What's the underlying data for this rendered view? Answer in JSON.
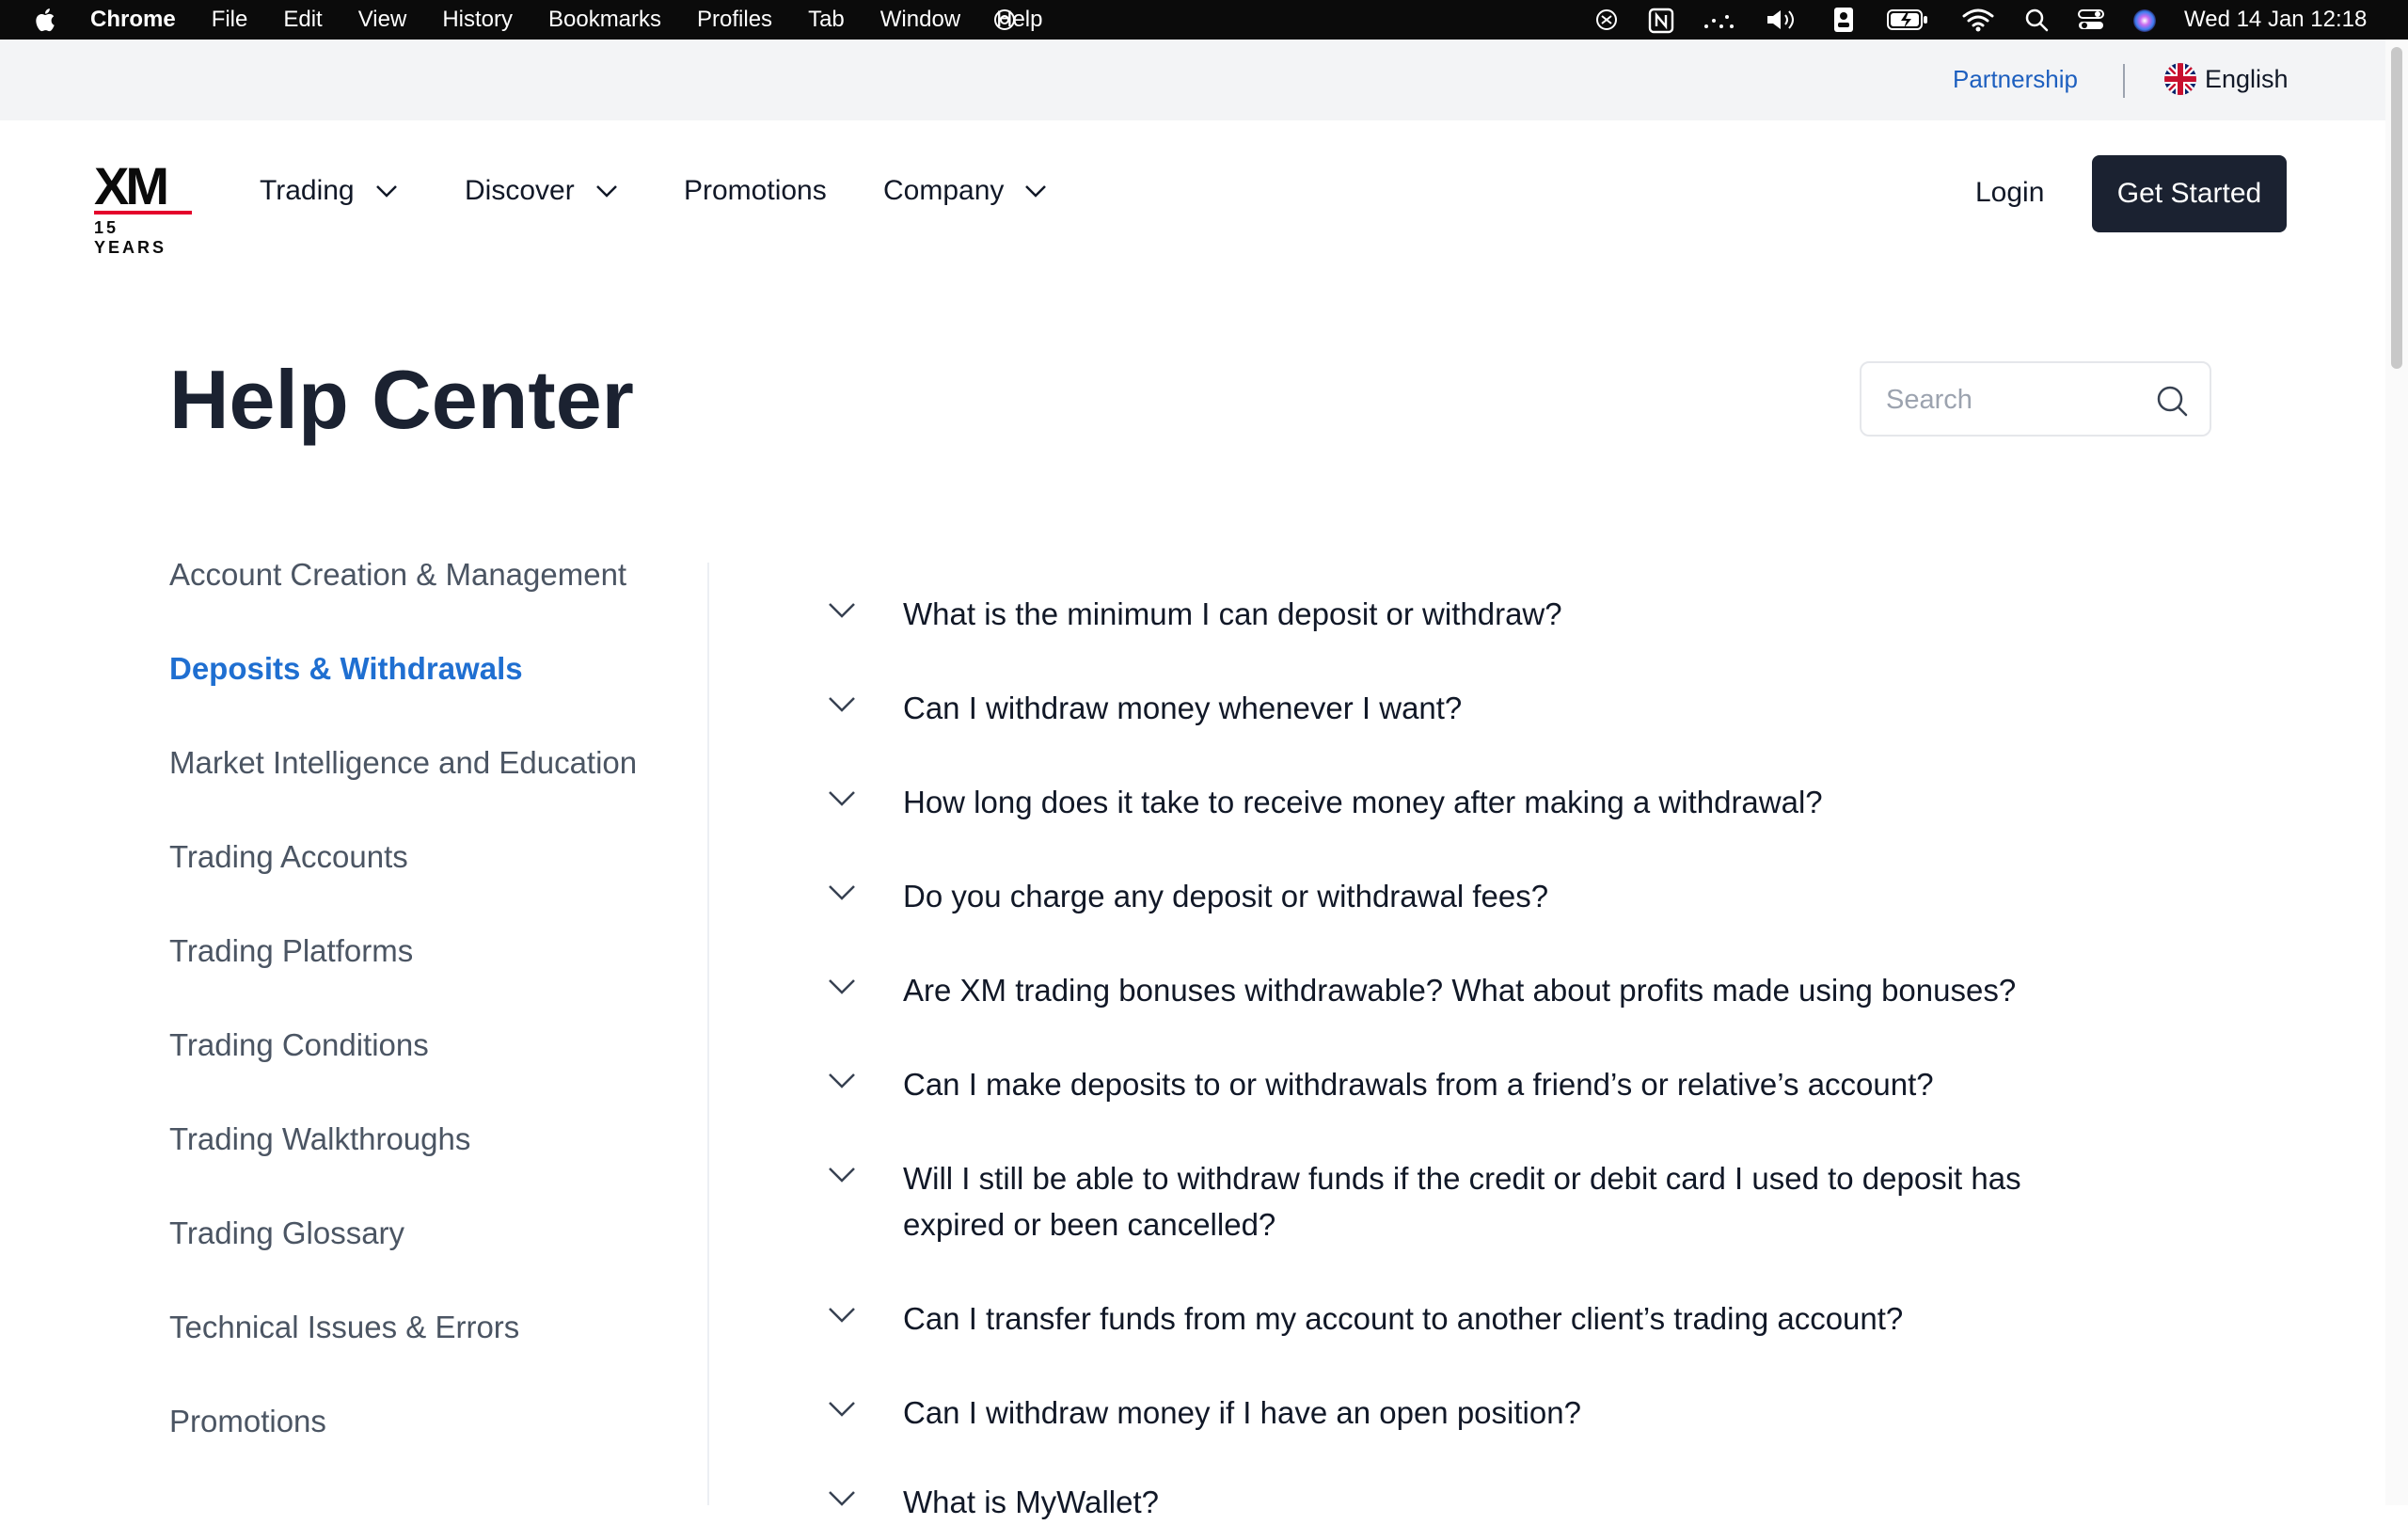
{
  "menubar": {
    "app": "Chrome",
    "items": [
      "File",
      "Edit",
      "View",
      "History",
      "Bookmarks",
      "Profiles",
      "Tab",
      "Window",
      "Help"
    ],
    "clock": "Wed 14 Jan  12:18"
  },
  "utility": {
    "partnership": "Partnership",
    "language": "English"
  },
  "nav": {
    "logo_text": "XM",
    "logo_sub": "15 YEARS",
    "items": [
      {
        "label": "Trading"
      },
      {
        "label": "Discover"
      },
      {
        "label": "Promotions"
      },
      {
        "label": "Company"
      }
    ],
    "login": "Login",
    "get_started": "Get Started"
  },
  "page": {
    "title": "Help Center",
    "search_placeholder": "Search"
  },
  "sidebar": {
    "items": [
      {
        "label": "Account Creation & Management"
      },
      {
        "label": "Deposits & Withdrawals",
        "active": true
      },
      {
        "label": "Market Intelligence and Education"
      },
      {
        "label": "Trading Accounts"
      },
      {
        "label": "Trading Platforms"
      },
      {
        "label": "Trading Conditions"
      },
      {
        "label": "Trading Walkthroughs"
      },
      {
        "label": "Trading Glossary"
      },
      {
        "label": "Technical Issues & Errors"
      },
      {
        "label": "Promotions"
      }
    ]
  },
  "faq": {
    "questions": [
      "What is the minimum I can deposit or withdraw?",
      "Can I withdraw money whenever I want?",
      "How long does it take to receive money after making a withdrawal?",
      "Do you charge any deposit or withdrawal fees?",
      "Are XM trading bonuses withdrawable? What about profits made using bonuses?",
      "Can I make deposits to or withdrawals from a friend’s or relative’s account?",
      "Will I still be able to withdraw funds if the credit or debit card I used to deposit has expired or been cancelled?",
      "Can I transfer funds from my account to another client’s trading account?",
      "Can I withdraw money if I have an open position?",
      "What is MyWallet?"
    ]
  },
  "colors": {
    "accent": "#1f6fd1",
    "primary_button": "#1b2231",
    "logo_red": "#e4002b"
  }
}
